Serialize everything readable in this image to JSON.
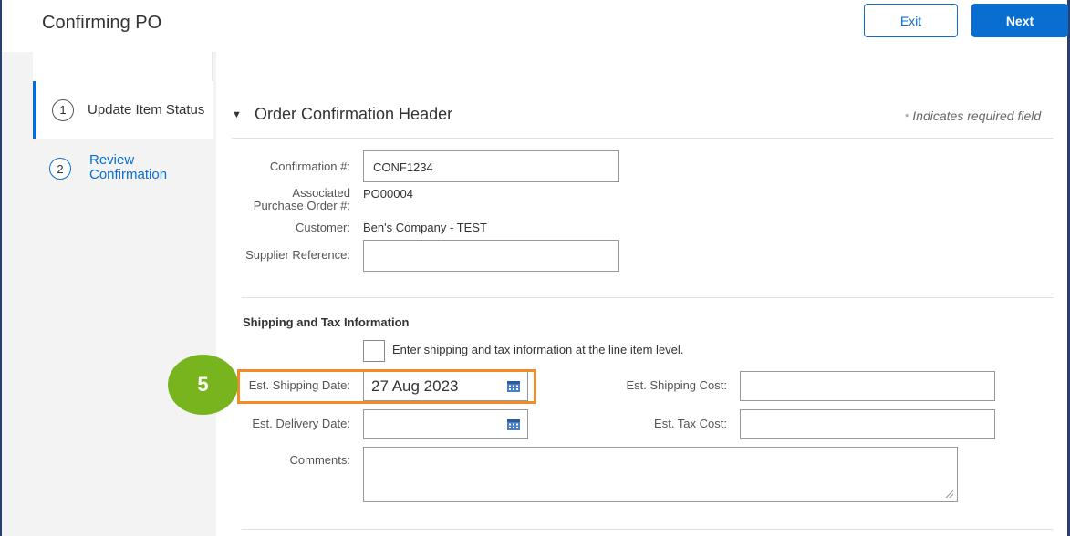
{
  "header": {
    "title": "Confirming PO",
    "exit_label": "Exit",
    "next_label": "Next"
  },
  "steps": [
    {
      "number": "1",
      "label": "Update Item Status",
      "active": true
    },
    {
      "number": "2",
      "label": "Review Confirmation",
      "active": false
    }
  ],
  "section": {
    "toggle_glyph": "▼",
    "title": "Order Confirmation Header",
    "required_star": "*",
    "required_note": "Indicates required field"
  },
  "form": {
    "confirmation_label": "Confirmation #:",
    "confirmation_value": "CONF1234",
    "po_label_line1": "Associated",
    "po_label_line2": "Purchase Order #:",
    "po_value": "PO00004",
    "customer_label": "Customer:",
    "customer_value": "Ben's Company - TEST",
    "supplier_ref_label": "Supplier Reference:",
    "supplier_ref_value": ""
  },
  "shipping": {
    "subheading": "Shipping and Tax Information",
    "line_item_checkbox_label": "Enter shipping and tax information at the line item level.",
    "line_item_checked": false,
    "est_shipping_date_label": "Est. Shipping Date:",
    "est_shipping_date_value": "27 Aug 2023",
    "est_delivery_date_label": "Est. Delivery Date:",
    "est_delivery_date_value": "",
    "est_shipping_cost_label": "Est. Shipping Cost:",
    "est_shipping_cost_value": "",
    "est_tax_cost_label": "Est. Tax Cost:",
    "est_tax_cost_value": "",
    "comments_label": "Comments:",
    "comments_value": ""
  },
  "callout": {
    "step_number": "5"
  },
  "colors": {
    "accent": "#0a6ed1",
    "highlight": "#f28c28",
    "badge": "#78b41e"
  }
}
